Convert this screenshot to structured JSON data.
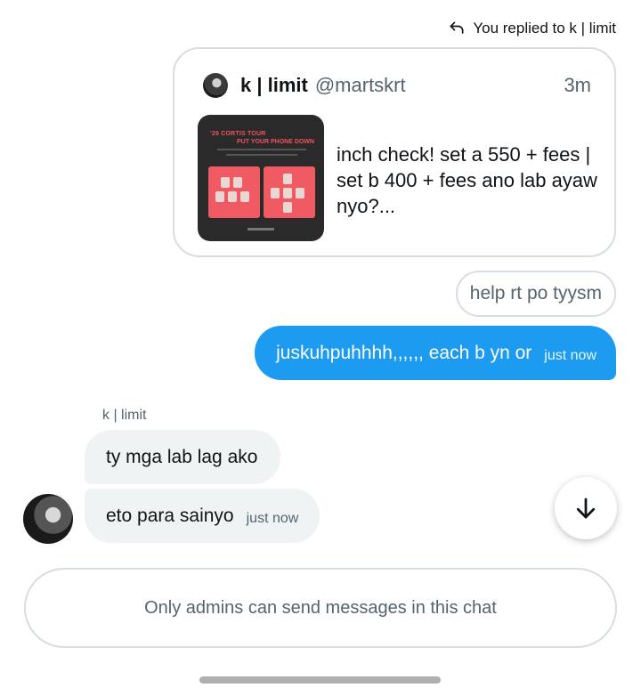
{
  "reply_note": {
    "label": "You replied to k | limit",
    "icon": "reply-arrow-icon"
  },
  "quoted_post": {
    "author_name": "k | limit",
    "author_handle": "@martskrt",
    "time": "3m",
    "text": "inch check! set a 550 + fees | set b 400 + fees ano lab ayaw nyo?...",
    "thumbnail": {
      "line1": "'26 CORTIS TOUR",
      "line2": "PUT YOUR PHONE DOWN"
    }
  },
  "messages": {
    "outgoing_help": "help rt po tyysm",
    "outgoing_main": {
      "text": "juskuhpuhhhh,,,,,, each b yn or",
      "time": "just now"
    },
    "incoming_sender": "k | limit",
    "incoming_1": "ty mga lab lag ako",
    "incoming_2": {
      "text": "eto para sainyo",
      "time": "just now"
    }
  },
  "composer": {
    "notice": "Only admins can send messages in this chat"
  },
  "colors": {
    "accent": "#1d9bf0",
    "incoming_bg": "#eff3f4",
    "muted_text": "#536471",
    "border": "#d6dde3"
  },
  "icons": {
    "scroll_down": "arrow-down-icon"
  }
}
